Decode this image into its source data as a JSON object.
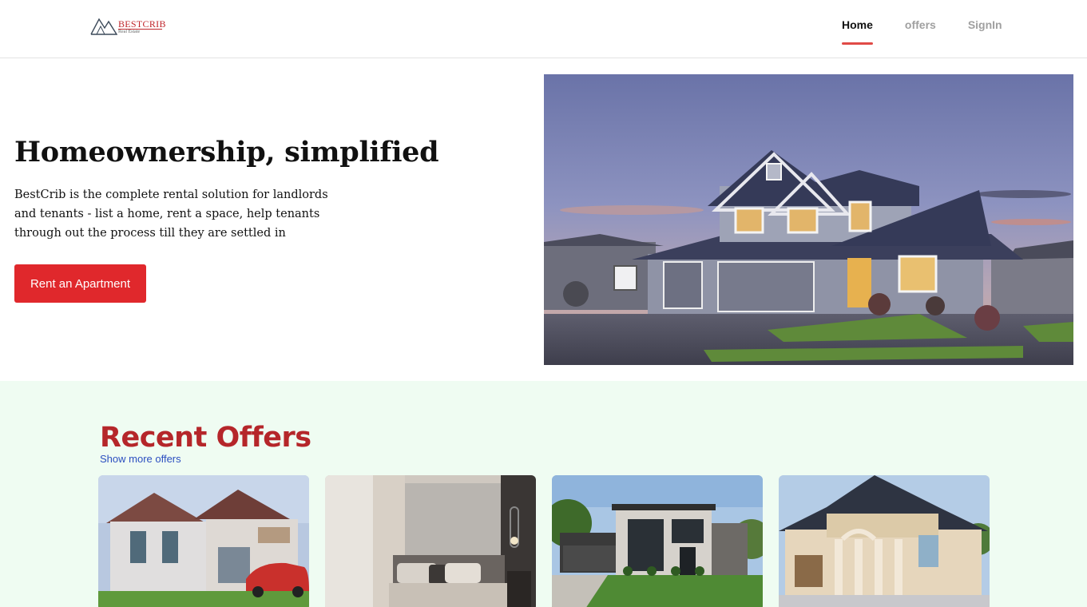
{
  "nav": {
    "logo_brand": "BESTCRIB",
    "logo_sub": "Real Estate",
    "links": [
      {
        "label": "Home",
        "active": true
      },
      {
        "label": "offers",
        "active": false
      },
      {
        "label": "SignIn",
        "active": false
      }
    ]
  },
  "hero": {
    "title": "Homeownership, simplified",
    "description": "BestCrib is the complete rental solution for landlords and tenants - list a home, rent a space, help tenants through out the process till they are settled in",
    "cta_label": "Rent an Apartment"
  },
  "offers": {
    "title": "Recent Offers",
    "more_link": "Show more offers",
    "cards": [
      {
        "image": "villa-with-red-car"
      },
      {
        "image": "bedroom-interior"
      },
      {
        "image": "modern-house-with-garage"
      },
      {
        "image": "mansion-with-columns"
      }
    ]
  },
  "colors": {
    "accent": "#e0282c",
    "title_red": "#b5262a",
    "offers_bg": "#effcf2",
    "link_blue": "#2b4fc0"
  }
}
